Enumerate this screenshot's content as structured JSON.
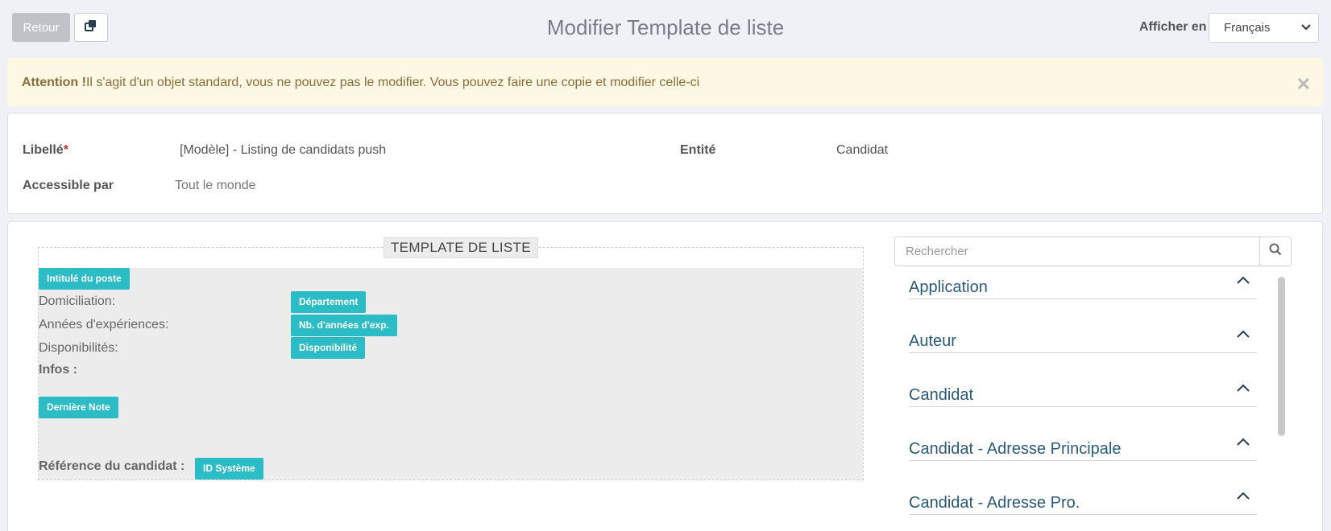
{
  "toolbar": {
    "back_label": "Retour",
    "copy_icon": "copy-icon",
    "title": "Modifier Template de liste",
    "display_in_label": "Afficher en",
    "language_selected": "Français"
  },
  "alert": {
    "strong": "Attention !",
    "message": "Il s'agit d'un objet standard, vous ne pouvez pas le modifier. Vous pouvez faire une copie et modifier celle-ci",
    "close_icon": "close-icon"
  },
  "info": {
    "libelle_label": "Libellé",
    "required_mark": "*",
    "libelle_value": "[Modèle] - Listing de candidats push",
    "entite_label": "Entité",
    "entite_value": "Candidat",
    "accessible_label": "Accessible par",
    "accessible_value": "Tout le monde"
  },
  "template": {
    "legend": "TEMPLATE DE LISTE",
    "chip_job_title": "Intitulé du poste",
    "domiciliation_label": "Domiciliation:",
    "chip_department": "Département",
    "experience_label": "Années d'expériences:",
    "chip_experience": "Nb. d'années d'exp.",
    "availability_label": "Disponibilités:",
    "chip_availability": "Disponibilité",
    "infos_label": "Infos :",
    "chip_last_note": "Dernière Note",
    "reference_label": "Référence du candidat :",
    "chip_system_id": "ID Système"
  },
  "sidebar": {
    "search_placeholder": "Rechercher",
    "sections": [
      {
        "label": "Application"
      },
      {
        "label": "Auteur"
      },
      {
        "label": "Candidat"
      },
      {
        "label": "Candidat - Adresse Principale"
      },
      {
        "label": "Candidat - Adresse Pro."
      }
    ]
  },
  "colors": {
    "chip": "#2bbcc6",
    "alert_bg": "#fcf8e3",
    "alert_text": "#8a6d3b",
    "section_text": "#2a5b7b"
  }
}
